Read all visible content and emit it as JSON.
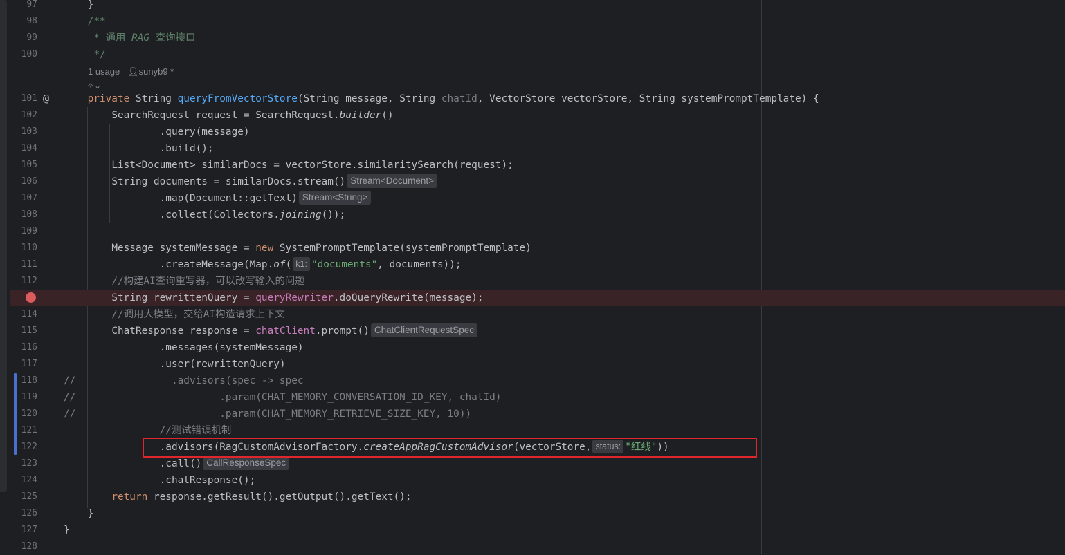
{
  "editor": {
    "usage_hint": {
      "usages": "1 usage",
      "author": "sunyb9 *"
    },
    "ai_hint_icon": "ai-assistant-icon",
    "colors": {
      "background": "#1e1f22",
      "breakpoint": "#db5c5c",
      "breakpoint_line": "#3a2326",
      "highlight_box": "#e0262d",
      "change_marker": "#4a6fce"
    },
    "lines": [
      {
        "num": "97",
        "text": "    }"
      },
      {
        "num": "98",
        "text": "    /**"
      },
      {
        "num": "99",
        "text": "     * 通用 RAG 查询接口"
      },
      {
        "num": "100",
        "text": "     */"
      },
      {
        "num": "101",
        "text": "    private String queryFromVectorStore(String message, String chatId, VectorStore vectorStore, String systemPromptTemplate) {"
      },
      {
        "num": "102",
        "text": "        SearchRequest request = SearchRequest.builder()"
      },
      {
        "num": "103",
        "text": "                .query(message)"
      },
      {
        "num": "104",
        "text": "                .build();"
      },
      {
        "num": "105",
        "text": "        List<Document> similarDocs = vectorStore.similaritySearch(request);"
      },
      {
        "num": "106",
        "text": "        String documents = similarDocs.stream()",
        "hint": "Stream<Document>"
      },
      {
        "num": "107",
        "text": "                .map(Document::getText)",
        "hint": "Stream<String>"
      },
      {
        "num": "108",
        "text": "                .collect(Collectors.joining());"
      },
      {
        "num": "109",
        "text": ""
      },
      {
        "num": "110",
        "text": "        Message systemMessage = new SystemPromptTemplate(systemPromptTemplate)"
      },
      {
        "num": "111",
        "text": "                .createMessage(Map.of(",
        "param_hint": "k1:",
        "rest": "\"documents\", documents));"
      },
      {
        "num": "112",
        "text": "        //构建AI查询重写器，可以改写输入的问题"
      },
      {
        "num": "113",
        "text": "        String rewrittenQuery = queryRewriter.doQueryRewrite(message);",
        "breakpoint": true
      },
      {
        "num": "114",
        "text": "        //调用大模型，交给AI构造请求上下文"
      },
      {
        "num": "115",
        "text": "        ChatResponse response = chatClient.prompt()",
        "hint": "ChatClientRequestSpec"
      },
      {
        "num": "116",
        "text": "                .messages(systemMessage)"
      },
      {
        "num": "117",
        "text": "                .user(rewrittenQuery)"
      },
      {
        "num": "118",
        "text": "//                .advisors(spec -> spec"
      },
      {
        "num": "119",
        "text": "//                        .param(CHAT_MEMORY_CONVERSATION_ID_KEY, chatId)"
      },
      {
        "num": "120",
        "text": "//                        .param(CHAT_MEMORY_RETRIEVE_SIZE_KEY, 10))"
      },
      {
        "num": "121",
        "text": "                //测试错误机制"
      },
      {
        "num": "122",
        "text": "                .advisors(RagCustomAdvisorFactory.createAppRagCustomAdvisor(vectorStore,",
        "param_hint": "status:",
        "rest": "\"红线\"))"
      },
      {
        "num": "123",
        "text": "                .call()",
        "hint": "CallResponseSpec"
      },
      {
        "num": "124",
        "text": "                .chatResponse();"
      },
      {
        "num": "125",
        "text": "        return response.getResult().getOutput().getText();"
      },
      {
        "num": "126",
        "text": "    }"
      },
      {
        "num": "127",
        "text": "}"
      },
      {
        "num": "128",
        "text": ""
      }
    ]
  },
  "tokens": {
    "l97": "}",
    "l98": "/**",
    "l99_star": "* 通用 ",
    "l99_rag": "RAG",
    "l99_rest": " 查询接口",
    "l100": "*/",
    "l101_kw": "private",
    "l101_type": " String ",
    "l101_fn": "queryFromVectorStore",
    "l101_a": "(String message, String ",
    "l101_chatid": "chatId",
    "l101_b": ", VectorStore vectorStore, String systemPromptTemplate) {",
    "l102_a": "SearchRequest request = SearchRequest.",
    "l102_it": "builder",
    "l102_b": "()",
    "l103": ".query(message)",
    "l104": ".build();",
    "l105": "List<Document> similarDocs = vectorStore.similaritySearch(request);",
    "l106": "String documents = similarDocs.stream()",
    "l106_hint": "Stream<Document>",
    "l107": ".map(Document::getText)",
    "l107_hint": "Stream<String>",
    "l108_a": ".collect(Collectors.",
    "l108_it": "joining",
    "l108_b": "());",
    "l110_a": "Message systemMessage = ",
    "l110_kw": "new",
    "l110_b": " SystemPromptTemplate(systemPromptTemplate)",
    "l111_a": ".createMessage(Map.",
    "l111_it": "of",
    "l111_b": "(",
    "l111_hint": "k1:",
    "l111_str": "\"documents\"",
    "l111_c": ", documents));",
    "l112": "//构建AI查询重写器，可以改写输入的问题",
    "l113_a": "String rewrittenQuery = ",
    "l113_fld": "queryRewriter",
    "l113_b": ".doQueryRewrite(message);",
    "l114": "//调用大模型，交给AI构造请求上下文",
    "l115_a": "ChatResponse response = ",
    "l115_fld": "chatClient",
    "l115_b": ".prompt()",
    "l115_hint": "ChatClientRequestSpec",
    "l116": ".messages(systemMessage)",
    "l117": ".user(rewrittenQuery)",
    "l118": "//                .advisors(spec -> spec",
    "l119": "//                        .param(CHAT_MEMORY_CONVERSATION_ID_KEY, chatId)",
    "l120": "//                        .param(CHAT_MEMORY_RETRIEVE_SIZE_KEY, 10))",
    "l121": "//测试错误机制",
    "l122_a": ".advisors(RagCustomAdvisorFactory.",
    "l122_it": "createAppRagCustomAdvisor",
    "l122_b": "(vectorStore,",
    "l122_hint": "status:",
    "l122_str": "\"红线\"",
    "l122_c": "))",
    "l123": ".call()",
    "l123_hint": "CallResponseSpec",
    "l124": ".chatResponse();",
    "l125_kw": "return",
    "l125_b": " response.getResult().getOutput().getText();",
    "l126": "}",
    "l127": "}"
  }
}
